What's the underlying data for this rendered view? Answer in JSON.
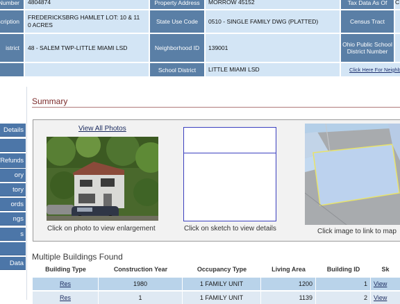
{
  "property_info": {
    "row1": {
      "label1": "Number",
      "value1": "4804874",
      "label2": "Property Address",
      "value2": "MORROW 45152",
      "label3": "Tax Data As Of",
      "value3": "C"
    },
    "row2": {
      "label1": "scription",
      "value1": "FREDERICKSBRG HAMLET LOT: 10 & 11 0 ACRES",
      "label2": "State Use Code",
      "value2": "0510 - SINGLE FAMILY DWG (PLATTED)",
      "label3": "Census Tract",
      "value3": ""
    },
    "row3": {
      "label1": "istrict",
      "value1": "48 - SALEM TWP-LITTLE MIAMI LSD",
      "label2": "Neighborhood ID",
      "value2": "139001",
      "label3": "Ohio Public School District Number",
      "value3": ""
    },
    "row4": {
      "label2": "School District",
      "value2": "LITTLE MIAMI LSD",
      "link3": "Click Here For Neighbo"
    }
  },
  "sidebar": {
    "items": [
      "Details",
      "",
      "/Refunds",
      "ory",
      "tory",
      "ords",
      "ngs",
      "s",
      "",
      "Data"
    ]
  },
  "summary": {
    "title": "Summary",
    "view_all_photos": "View All Photos",
    "photo_caption": "Click on photo to view enlargement",
    "sketch_caption": "Click on sketch to view details",
    "map_caption": "Click image to link to map"
  },
  "buildings": {
    "title": "Multiple Buildings Found",
    "headers": [
      "Building Type",
      "Construction Year",
      "Occupancy Type",
      "Living Area",
      "Building ID",
      "Sk"
    ],
    "rows": [
      [
        "Res",
        "1980",
        "1 FAMILY UNIT",
        "1200",
        "1",
        "View"
      ],
      [
        "Res",
        "1",
        "1 FAMILY UNIT",
        "1139",
        "2",
        "View"
      ]
    ]
  },
  "colors": {
    "label_bg": "#5a7fa6",
    "value_bg": "#d3e5f5",
    "sidebar_bg": "#4c76a8",
    "summary_title": "#7b2a2a"
  }
}
